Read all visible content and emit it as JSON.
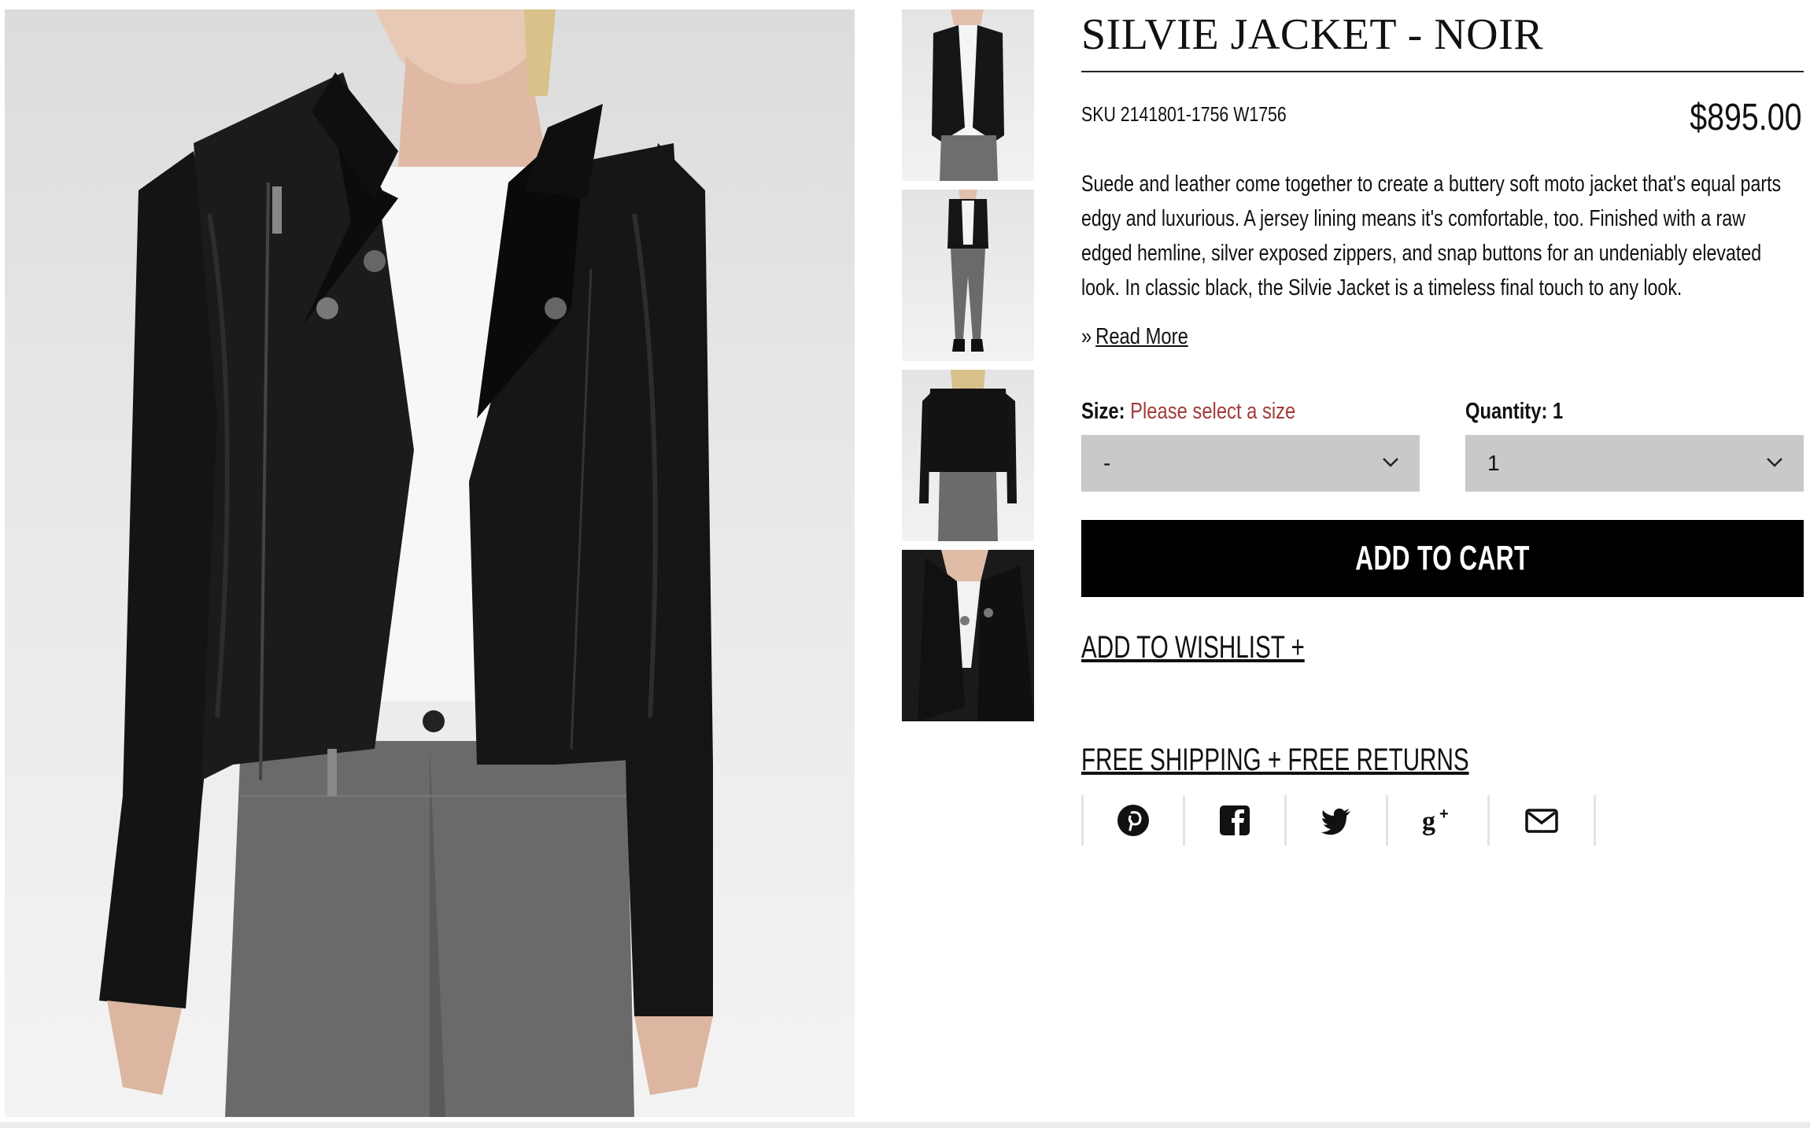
{
  "product": {
    "title": "SILVIE JACKET - NOIR",
    "sku": "SKU 2141801-1756 W1756",
    "price": "$895.00",
    "description": "Suede and leather come together to create a buttery soft moto jacket that's equal parts edgy and luxurious. A jersey lining means it's comfortable, too. Finished with a raw edged hemline, silver exposed zippers, and snap buttons for an undeniably elevated look. In classic black, the Silvie Jacket is a timeless final touch to any look.",
    "read_more": "Read More",
    "read_more_icon": "double-chevron-right-icon"
  },
  "size": {
    "label": "Size:",
    "hint": "Please select a size",
    "value": "-"
  },
  "quantity": {
    "label": "Quantity: 1",
    "value": "1"
  },
  "actions": {
    "add_to_cart": "ADD TO CART",
    "wishlist": "ADD TO WISHLIST +",
    "shipping": "FREE SHIPPING + FREE RETURNS"
  },
  "share_icons": [
    "pinterest-icon",
    "facebook-icon",
    "twitter-icon",
    "google-plus-icon",
    "email-icon"
  ],
  "colors": {
    "button_bg": "#000000",
    "select_bg": "#c9c9c9",
    "hint": "#a33a3a"
  }
}
